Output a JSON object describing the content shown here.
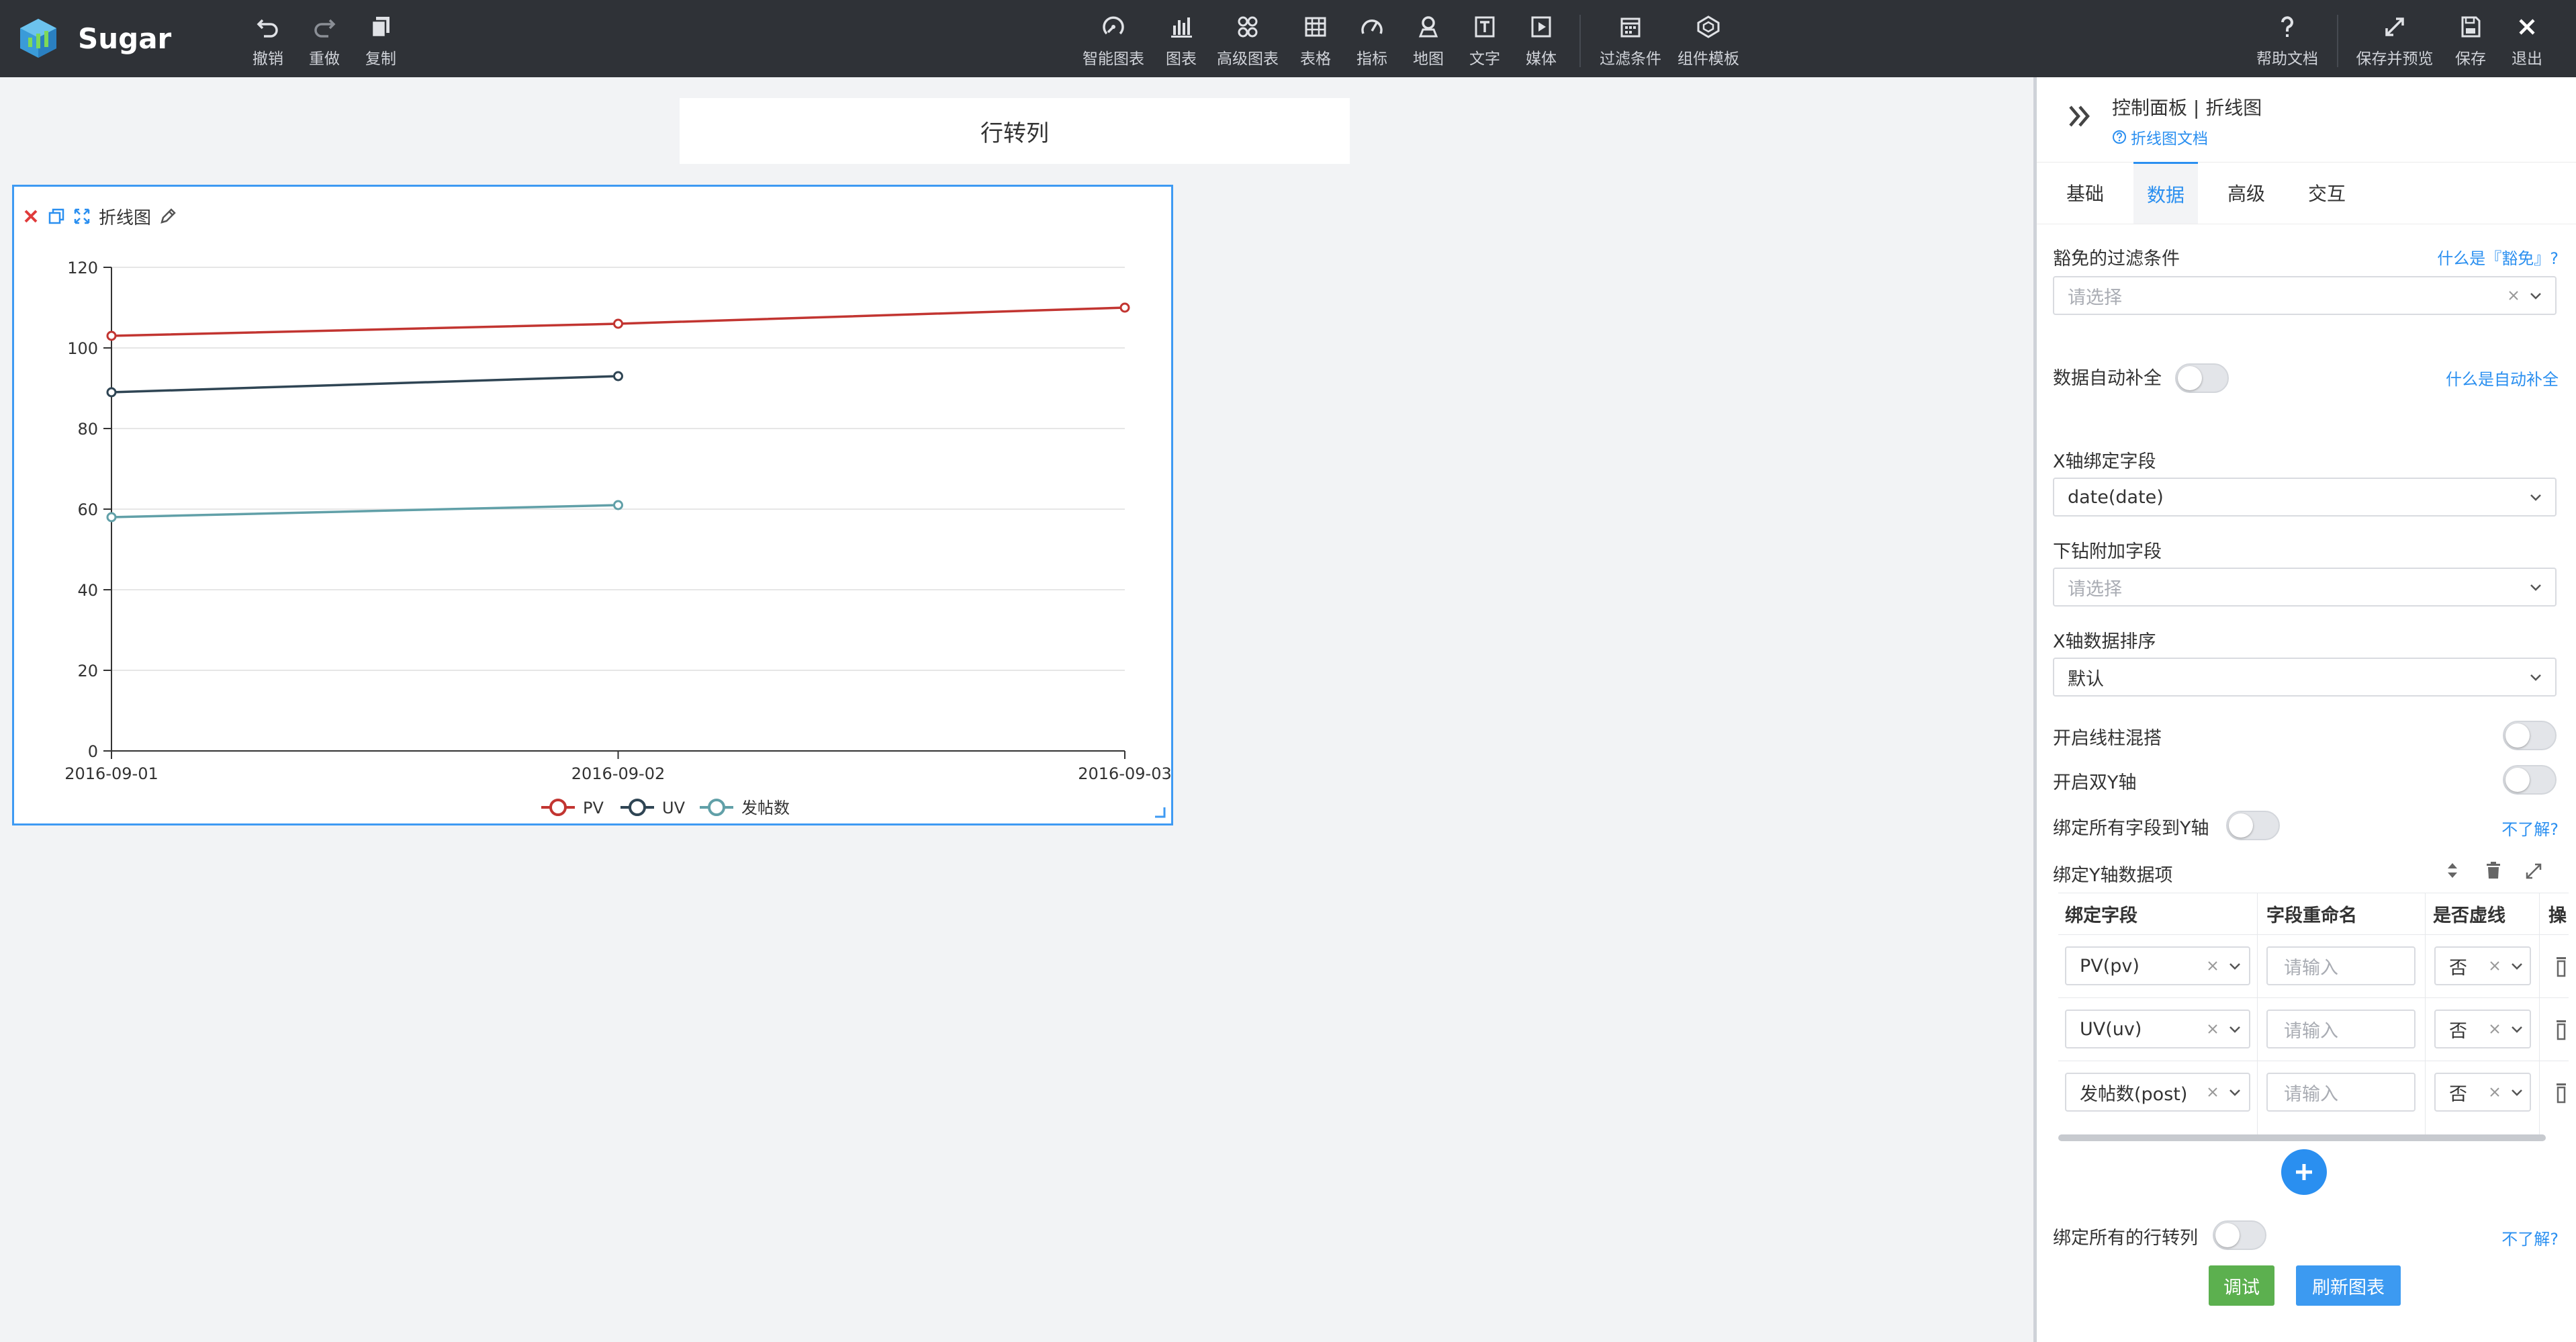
{
  "app": {
    "name": "Sugar"
  },
  "toolbar": {
    "left": [
      {
        "label": "撤销",
        "icon": "undo-icon"
      },
      {
        "label": "重做",
        "icon": "redo-icon"
      },
      {
        "label": "复制",
        "icon": "copy-icon"
      }
    ],
    "center": [
      {
        "label": "智能图表",
        "icon": "smart-chart-icon"
      },
      {
        "label": "图表",
        "icon": "bar-chart-icon"
      },
      {
        "label": "高级图表",
        "icon": "advanced-chart-icon"
      },
      {
        "label": "表格",
        "icon": "table-icon"
      },
      {
        "label": "指标",
        "icon": "gauge-icon"
      },
      {
        "label": "地图",
        "icon": "map-pin-icon"
      },
      {
        "label": "文字",
        "icon": "text-icon"
      },
      {
        "label": "媒体",
        "icon": "media-play-icon"
      },
      {
        "label": "过滤条件",
        "icon": "filter-calendar-icon"
      },
      {
        "label": "组件模板",
        "icon": "component-template-icon"
      }
    ],
    "right": [
      {
        "label": "帮助文档",
        "icon": "help-icon"
      },
      {
        "label": "保存并预览",
        "icon": "expand-icon"
      },
      {
        "label": "保存",
        "icon": "save-icon"
      },
      {
        "label": "退出",
        "icon": "close-icon"
      }
    ]
  },
  "canvas": {
    "title": "行转列",
    "widget": {
      "name": "折线图"
    }
  },
  "chart_data": {
    "type": "line",
    "categories": [
      "2016-09-01",
      "2016-09-02",
      "2016-09-03"
    ],
    "series": [
      {
        "name": "PV",
        "values": [
          103,
          106,
          110
        ],
        "color": "#c23531"
      },
      {
        "name": "UV",
        "values": [
          89,
          93,
          null
        ],
        "color": "#2f4554"
      },
      {
        "name": "发帖数",
        "values": [
          58,
          61,
          null
        ],
        "color": "#61a0a8"
      }
    ],
    "yticks": [
      0,
      20,
      40,
      60,
      80,
      100,
      120
    ],
    "ylim": [
      0,
      120
    ],
    "grid": true,
    "legend": "bottom-center"
  },
  "panel": {
    "title": "控制面板 | 折线图",
    "doc_link": "折线图文档",
    "tabs": [
      "基础",
      "数据",
      "高级",
      "交互"
    ],
    "active_tab": "数据",
    "filter_label": "豁免的过滤条件",
    "filter_link": "什么是『豁免』?",
    "filter_placeholder": "请选择",
    "auto_fill_label": "数据自动补全",
    "auto_fill_link": "什么是自动补全",
    "x_field_label": "X轴绑定字段",
    "x_field_value": "date(date)",
    "drill_label": "下钻附加字段",
    "drill_placeholder": "请选择",
    "x_sort_label": "X轴数据排序",
    "x_sort_value": "默认",
    "line_bar_mix_label": "开启线柱混搭",
    "dual_y_label": "开启双Y轴",
    "bind_all_y_label": "绑定所有字段到Y轴",
    "bind_all_y_link": "不了解?",
    "y_items_label": "绑定Y轴数据项",
    "table": {
      "headers": [
        "绑定字段",
        "字段重命名",
        "是否虚线",
        "操"
      ],
      "rows": [
        {
          "field": "PV(pv)",
          "rename_placeholder": "请输入",
          "dashed": "否"
        },
        {
          "field": "UV(uv)",
          "rename_placeholder": "请输入",
          "dashed": "否"
        },
        {
          "field": "发帖数(post)",
          "rename_placeholder": "请输入",
          "dashed": "否"
        }
      ]
    },
    "bind_all_rows_label": "绑定所有的行转列",
    "bind_all_rows_link": "不了解?",
    "debug_button": "调试",
    "refresh_button": "刷新图表",
    "colors": {
      "accent": "#2a8ff0",
      "debug": "#5cb04f",
      "refresh": "#3c9af1"
    }
  }
}
